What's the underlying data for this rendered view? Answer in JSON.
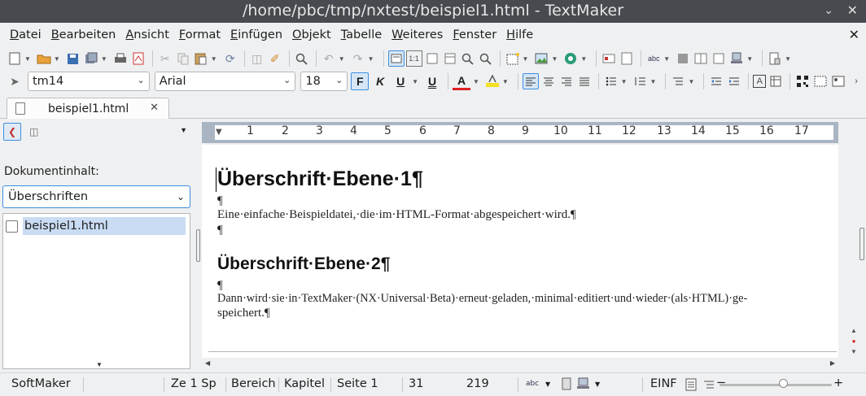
{
  "window": {
    "title": "/home/pbc/tmp/nxtest/beispiel1.html - TextMaker"
  },
  "menu": [
    "Datei",
    "Bearbeiten",
    "Ansicht",
    "Format",
    "Einfügen",
    "Objekt",
    "Tabelle",
    "Weiteres",
    "Fenster",
    "Hilfe"
  ],
  "format_bar": {
    "style": "tm14",
    "font": "Arial",
    "size": "18",
    "bold_label": "F",
    "italic_label": "K",
    "underline_label": "U",
    "underline2_label": "U",
    "color_label": "A"
  },
  "tab": {
    "label": "beispiel1.html"
  },
  "navigator": {
    "section_label": "Dokumentinhalt:",
    "mode": "Überschriften",
    "tree_item": "beispiel1.html"
  },
  "ruler": {
    "numbers": [
      "1",
      "1",
      "2",
      "3",
      "4",
      "5",
      "6",
      "7",
      "8",
      "9",
      "10",
      "11",
      "12",
      "13",
      "14",
      "15",
      "16",
      "17"
    ]
  },
  "document": {
    "heading1": "Überschrift·Ebene·1¶",
    "pilcrow1": "¶",
    "para1": "Eine·einfache·Beispieldatei,·die·im·HTML-Format·abgespeichert·wird.¶",
    "pilcrow2": "¶",
    "heading2": "Überschrift·Ebene·2¶",
    "pilcrow3": "¶",
    "para2_line1": "Dann·wird·sie·in·TextMaker·(NX·Universal·Beta)·erneut·geladen,·minimal·editiert·und·wieder·(als·HTML)·ge-",
    "para2_line2": "speichert.¶"
  },
  "status": {
    "brand": "SoftMaker",
    "position": "Ze 1 Sp",
    "area": "Bereich",
    "chapter": "Kapitel",
    "page": "Seite 1",
    "num1": "31",
    "num2": "219",
    "mode": "EINF"
  }
}
